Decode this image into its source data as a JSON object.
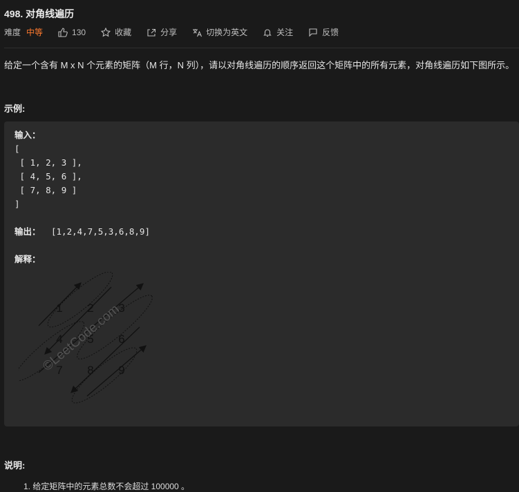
{
  "problem": {
    "title": "498. 对角线遍历",
    "difficulty_label": "难度",
    "difficulty": "中等",
    "likes": "130",
    "favorite": "收藏",
    "share": "分享",
    "switch_lang": "切换为英文",
    "follow": "关注",
    "feedback": "反馈",
    "description": "给定一个含有 M x N 个元素的矩阵（M 行，N 列），请以对角线遍历的顺序返回这个矩阵中的所有元素，对角线遍历如下图所示。",
    "example_heading": "示例:",
    "input_label": "输入：",
    "input_lines": [
      "[",
      " [ 1, 2, 3 ],",
      " [ 4, 5, 6 ],",
      " [ 7, 8, 9 ]",
      "]"
    ],
    "output_label": "输出：",
    "output_value": "[1,2,4,7,5,3,6,8,9]",
    "explain_label": "解释：",
    "diagram_numbers": [
      "1",
      "2",
      "3",
      "4",
      "5",
      "6",
      "7",
      "8",
      "9"
    ],
    "watermark": "©LeetCode.com",
    "notes_heading": "说明:",
    "notes": [
      "1. 给定矩阵中的元素总数不会超过 100000 。"
    ]
  },
  "colors": {
    "accent": "#ff7a2f",
    "background": "#1a1a1a",
    "panel": "#2b2b2b"
  }
}
